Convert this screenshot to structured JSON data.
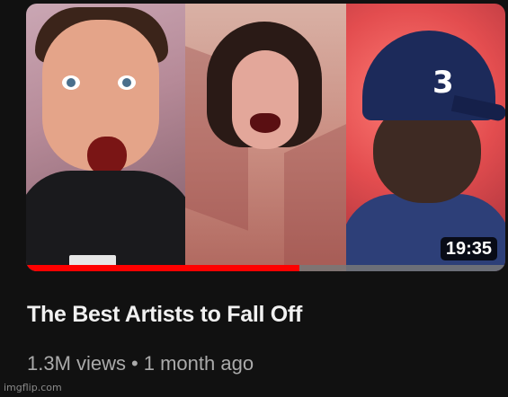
{
  "video": {
    "duration": "19:35",
    "watch_progress": 0.57,
    "title": "The Best Artists to Fall Off",
    "views": "1.3M views",
    "separator": "•",
    "age": "1 month ago"
  },
  "thumbnail": {
    "panels": [
      "excited-man-in-black-shirt",
      "singer-with-curly-hair",
      "man-in-blue-cap"
    ],
    "cap_number": "3"
  },
  "watermark": "imgflip.com",
  "colors": {
    "background": "#111111",
    "title": "#f1f1f1",
    "meta": "#aaaaaa",
    "progress": "#ff0000"
  }
}
